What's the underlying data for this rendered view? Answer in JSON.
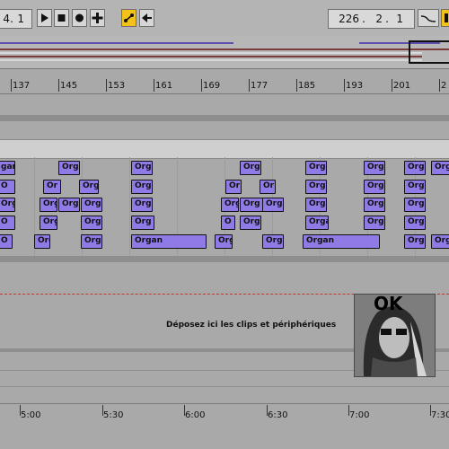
{
  "transport": {
    "position": {
      "bars": "4",
      "beats": "1"
    },
    "end_position": {
      "bars": "226",
      "beats": "2",
      "sixteenths": "1"
    }
  },
  "ruler": {
    "bars": [
      "137",
      "145",
      "153",
      "161",
      "169",
      "177",
      "185",
      "193",
      "201",
      "2"
    ]
  },
  "clips": {
    "organ_label": "Organ",
    "organ_short": "Orga",
    "organ_trunc": "Org",
    "organ_or": "Or",
    "organ_o": "O",
    "organ_gan": "gan"
  },
  "drop_area": {
    "text": "Déposez ici les clips et périphériques"
  },
  "preview": {
    "overlay_text": "OK"
  },
  "time_ruler": {
    "labels": [
      "5:00",
      "5:30",
      "6:00",
      "6:30",
      "7:00",
      "7:30"
    ]
  },
  "colors": {
    "clip": "#8f7ae6",
    "accent": "#f2c21b",
    "background": "#a9a9a9"
  }
}
